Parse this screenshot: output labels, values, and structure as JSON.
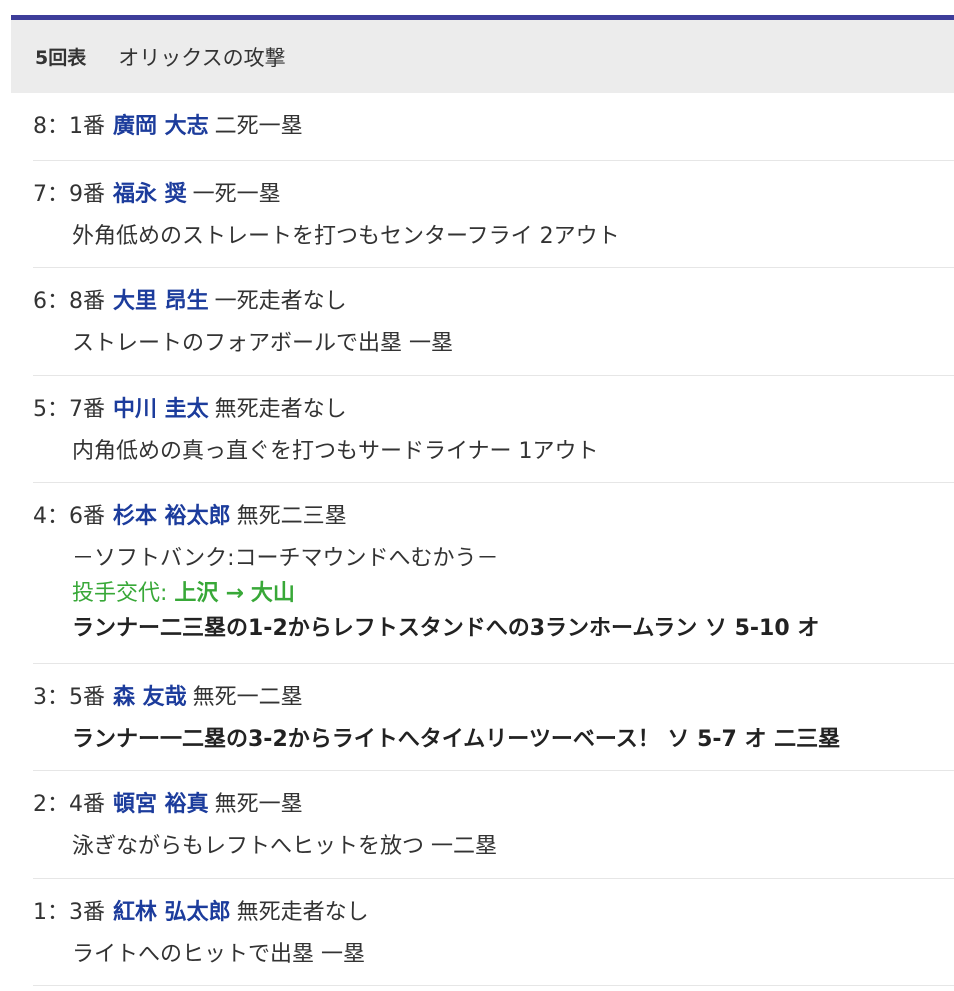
{
  "inning": {
    "label": "5回表",
    "team_attack": "オリックスの攻撃"
  },
  "at_bats": [
    {
      "order": "8：1番",
      "player": "廣岡 大志",
      "situation": "二死一塁",
      "lines": []
    },
    {
      "order": "7：9番",
      "player": "福永 奨",
      "situation": "一死一塁",
      "lines": [
        "外角低めのストレートを打つもセンターフライ 2アウト"
      ]
    },
    {
      "order": "6：8番",
      "player": "大里 昂生",
      "situation": "一死走者なし",
      "lines": [
        "ストレートのフォアボールで出塁 一塁"
      ]
    },
    {
      "order": "5：7番",
      "player": "中川 圭太",
      "situation": "無死走者なし",
      "lines": [
        "内角低めの真っ直ぐを打つもサードライナー 1アウト"
      ]
    },
    {
      "order": "4：6番",
      "player": "杉本 裕太郎",
      "situation": "無死二三塁",
      "event": "－ソフトバンク:コーチマウンドへむかう－",
      "pitching_change": {
        "label": "投手交代:",
        "from": "上沢",
        "arrow": "→",
        "to": "大山"
      },
      "big_play": "ランナー二三塁の1-2からレフトスタンドへの3ランホームラン ソ 5-10 オ"
    },
    {
      "order": "3：5番",
      "player": "森 友哉",
      "situation": "無死一二塁",
      "big_play": "ランナー一二塁の3-2からライトへタイムリーツーベース！ ソ 5-7 オ 二三塁"
    },
    {
      "order": "2：4番",
      "player": "頓宮 裕真",
      "situation": "無死一塁",
      "lines": [
        "泳ぎながらもレフトへヒットを放つ 一二塁"
      ]
    },
    {
      "order": "1：3番",
      "player": "紅林 弘太郎",
      "situation": "無死走者なし",
      "lines": [
        "ライトへのヒットで出塁 一塁"
      ]
    }
  ],
  "colors": {
    "accent_rule": "#3d3d9a",
    "header_bg": "#ececec",
    "player_name": "#1c3c9c",
    "pitching_change": "#38a838"
  }
}
